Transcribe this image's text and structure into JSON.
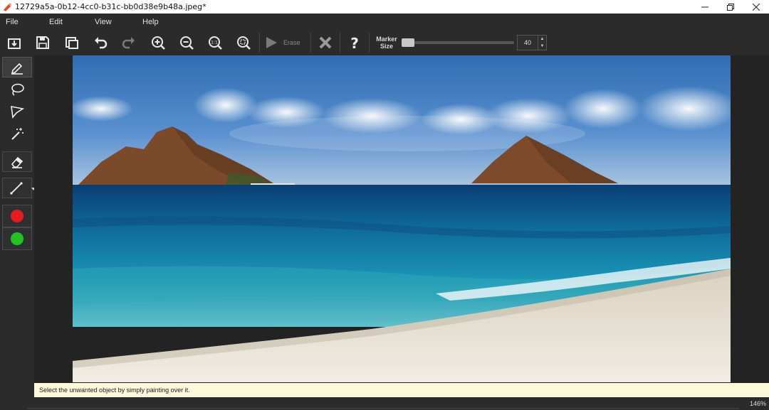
{
  "window": {
    "title": "12729a5a-0b12-4cc0-b31c-bb0d38e9b48a.jpeg*",
    "controls": [
      "minimize",
      "restore",
      "close"
    ]
  },
  "menu": {
    "items": [
      "File",
      "Edit",
      "View",
      "Help"
    ]
  },
  "toolbar": {
    "buttons": [
      {
        "name": "open-icon"
      },
      {
        "name": "save-icon"
      },
      {
        "name": "compare-icon"
      },
      {
        "name": "undo-icon"
      },
      {
        "name": "redo-icon"
      },
      {
        "name": "zoom-in-icon"
      },
      {
        "name": "zoom-out-icon"
      },
      {
        "name": "zoom-actual-size-icon"
      },
      {
        "name": "zoom-fit-icon"
      }
    ],
    "erase_label": "Erase",
    "marker_label_line1": "Marker",
    "marker_label_line2": "Size",
    "marker_size": "40",
    "cancel_icon": "close-x-icon",
    "help_icon": "question-mark-icon"
  },
  "tools": [
    {
      "name": "marker-tool",
      "icon": "pencil-icon",
      "active": true
    },
    {
      "name": "lasso-tool",
      "icon": "lasso-icon"
    },
    {
      "name": "polygon-lasso-tool",
      "icon": "polygon-lasso-icon"
    },
    {
      "name": "magic-wand-tool",
      "icon": "magic-wand-icon"
    },
    {
      "name": "eraser-tool",
      "icon": "eraser-icon"
    },
    {
      "name": "line-tool",
      "icon": "line-icon"
    },
    {
      "name": "red-marker-color",
      "color": "#e61c1c"
    },
    {
      "name": "green-marker-color",
      "color": "#22c422"
    }
  ],
  "hint": {
    "text": "Select the unwanted object by simply painting over it."
  },
  "status": {
    "zoom": "146%"
  }
}
